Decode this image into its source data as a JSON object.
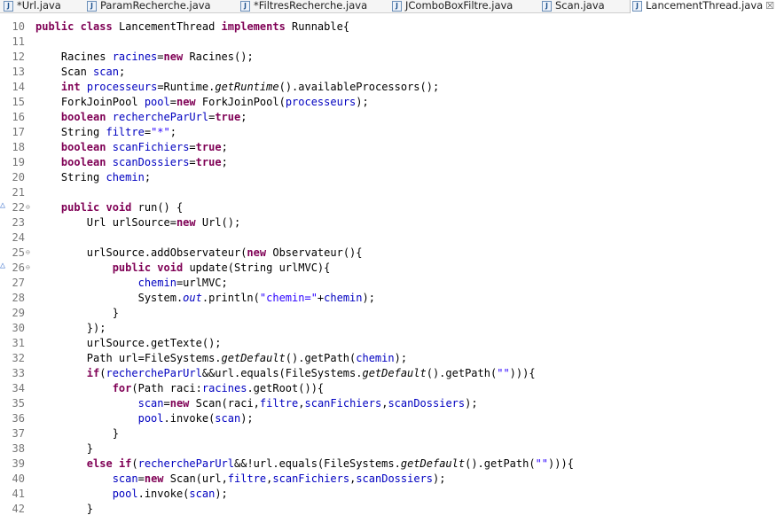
{
  "tabs": [
    {
      "label": "*Url.java",
      "icon": "java-file-icon",
      "active": false
    },
    {
      "label": "ParamRecherche.java",
      "icon": "java-file-icon",
      "active": false
    },
    {
      "label": "*FiltresRecherche.java",
      "icon": "java-file-icon",
      "active": false
    },
    {
      "label": "JComboBoxFiltre.java",
      "icon": "java-file-icon",
      "active": false
    },
    {
      "label": "Scan.java",
      "icon": "java-file-icon",
      "active": false
    },
    {
      "label": "LancementThread.java",
      "icon": "java-file-icon",
      "active": true,
      "close": "☒"
    }
  ],
  "icon_glyph": "J",
  "lines": [
    {
      "n": "10",
      "seg": [
        [
          "k",
          "public"
        ],
        [
          "",
          ""
        ],
        [
          "k",
          "class"
        ],
        [
          "",
          ""
        ],
        [
          "",
          "LancementThread "
        ],
        [
          "k",
          "implements"
        ],
        [
          "",
          ""
        ],
        [
          "",
          "Runnable{"
        ]
      ]
    },
    {
      "n": "11",
      "seg": []
    },
    {
      "n": "12",
      "seg": [
        [
          "",
          "    Racines "
        ],
        [
          "f",
          "racines"
        ],
        [
          "",
          "="
        ],
        [
          "k",
          "new"
        ],
        [
          "",
          ""
        ],
        [
          "",
          "Racines();"
        ]
      ]
    },
    {
      "n": "13",
      "seg": [
        [
          "",
          "    Scan "
        ],
        [
          "f",
          "scan"
        ],
        [
          "",
          ";"
        ]
      ]
    },
    {
      "n": "14",
      "seg": [
        [
          "",
          "    "
        ],
        [
          "k",
          "int"
        ],
        [
          "",
          ""
        ],
        [
          "f",
          "processeurs"
        ],
        [
          "",
          "=Runtime."
        ],
        [
          "i",
          "getRuntime"
        ],
        [
          "",
          "().availableProcessors();"
        ]
      ]
    },
    {
      "n": "15",
      "seg": [
        [
          "",
          "    ForkJoinPool "
        ],
        [
          "f",
          "pool"
        ],
        [
          "",
          "="
        ],
        [
          "k",
          "new"
        ],
        [
          "",
          ""
        ],
        [
          "",
          "ForkJoinPool("
        ],
        [
          "f",
          "processeurs"
        ],
        [
          "",
          ");"
        ]
      ]
    },
    {
      "n": "16",
      "seg": [
        [
          "",
          "    "
        ],
        [
          "k",
          "boolean"
        ],
        [
          "",
          ""
        ],
        [
          "f",
          "rechercheParUrl"
        ],
        [
          "",
          "="
        ],
        [
          "k",
          "true"
        ],
        [
          "",
          ";"
        ]
      ]
    },
    {
      "n": "17",
      "seg": [
        [
          "",
          "    String "
        ],
        [
          "f",
          "filtre"
        ],
        [
          "",
          "="
        ],
        [
          "s",
          "\"*\""
        ],
        [
          "",
          ";"
        ]
      ]
    },
    {
      "n": "18",
      "seg": [
        [
          "",
          "    "
        ],
        [
          "k",
          "boolean"
        ],
        [
          "",
          ""
        ],
        [
          "f",
          "scanFichiers"
        ],
        [
          "",
          "="
        ],
        [
          "k",
          "true"
        ],
        [
          "",
          ";"
        ]
      ]
    },
    {
      "n": "19",
      "seg": [
        [
          "",
          "    "
        ],
        [
          "k",
          "boolean"
        ],
        [
          "",
          ""
        ],
        [
          "f",
          "scanDossiers"
        ],
        [
          "",
          "="
        ],
        [
          "k",
          "true"
        ],
        [
          "",
          ";"
        ]
      ]
    },
    {
      "n": "20",
      "seg": [
        [
          "",
          "    String "
        ],
        [
          "f",
          "chemin"
        ],
        [
          "",
          ";"
        ]
      ]
    },
    {
      "n": "21",
      "seg": []
    },
    {
      "n": "22",
      "marker": "△",
      "fold": "⊖",
      "seg": [
        [
          "",
          "    "
        ],
        [
          "k",
          "public"
        ],
        [
          "",
          ""
        ],
        [
          "k",
          "void"
        ],
        [
          "",
          ""
        ],
        [
          "",
          "run() {"
        ]
      ]
    },
    {
      "n": "23",
      "seg": [
        [
          "",
          "        Url urlSource="
        ],
        [
          "k",
          "new"
        ],
        [
          "",
          ""
        ],
        [
          "",
          "Url();"
        ]
      ]
    },
    {
      "n": "24",
      "seg": []
    },
    {
      "n": "25",
      "fold": "⊖",
      "seg": [
        [
          "",
          "        urlSource.addObservateur("
        ],
        [
          "k",
          "new"
        ],
        [
          "",
          ""
        ],
        [
          "",
          "Observateur(){"
        ]
      ]
    },
    {
      "n": "26",
      "marker": "△",
      "fold": "⊖",
      "seg": [
        [
          "",
          "            "
        ],
        [
          "k",
          "public"
        ],
        [
          "",
          ""
        ],
        [
          "k",
          "void"
        ],
        [
          "",
          ""
        ],
        [
          "",
          "update(String urlMVC){"
        ]
      ]
    },
    {
      "n": "27",
      "seg": [
        [
          "",
          "                "
        ],
        [
          "f",
          "chemin"
        ],
        [
          "",
          "=urlMVC;"
        ]
      ]
    },
    {
      "n": "28",
      "seg": [
        [
          "",
          "                System."
        ],
        [
          "fi",
          "out"
        ],
        [
          "",
          ".println("
        ],
        [
          "s",
          "\"chemin=\""
        ],
        [
          "",
          "+"
        ],
        [
          "f",
          "chemin"
        ],
        [
          "",
          ");"
        ]
      ]
    },
    {
      "n": "29",
      "seg": [
        [
          "",
          "            }"
        ]
      ]
    },
    {
      "n": "30",
      "seg": [
        [
          "",
          "        });"
        ]
      ]
    },
    {
      "n": "31",
      "seg": [
        [
          "",
          "        urlSource.getTexte();"
        ]
      ]
    },
    {
      "n": "32",
      "seg": [
        [
          "",
          "        Path url=FileSystems."
        ],
        [
          "i",
          "getDefault"
        ],
        [
          "",
          "().getPath("
        ],
        [
          "f",
          "chemin"
        ],
        [
          "",
          ");"
        ]
      ]
    },
    {
      "n": "33",
      "seg": [
        [
          "",
          "        "
        ],
        [
          "k",
          "if"
        ],
        [
          "",
          "("
        ],
        [
          "f",
          "rechercheParUrl"
        ],
        [
          "",
          "&&url.equals(FileSystems."
        ],
        [
          "i",
          "getDefault"
        ],
        [
          "",
          "().getPath("
        ],
        [
          "s",
          "\"\""
        ],
        [
          "",
          "))){"
        ]
      ]
    },
    {
      "n": "34",
      "seg": [
        [
          "",
          "            "
        ],
        [
          "k",
          "for"
        ],
        [
          "",
          "(Path raci:"
        ],
        [
          "f",
          "racines"
        ],
        [
          "",
          ".getRoot()){"
        ]
      ]
    },
    {
      "n": "35",
      "seg": [
        [
          "",
          "                "
        ],
        [
          "f",
          "scan"
        ],
        [
          "",
          "="
        ],
        [
          "k",
          "new"
        ],
        [
          "",
          ""
        ],
        [
          "",
          "Scan(raci,"
        ],
        [
          "f",
          "filtre"
        ],
        [
          "",
          ","
        ],
        [
          "f",
          "scanFichiers"
        ],
        [
          "",
          ","
        ],
        [
          "f",
          "scanDossiers"
        ],
        [
          "",
          ");"
        ]
      ]
    },
    {
      "n": "36",
      "seg": [
        [
          "",
          "                "
        ],
        [
          "f",
          "pool"
        ],
        [
          "",
          ".invoke("
        ],
        [
          "f",
          "scan"
        ],
        [
          "",
          ");"
        ]
      ]
    },
    {
      "n": "37",
      "seg": [
        [
          "",
          "            }"
        ]
      ]
    },
    {
      "n": "38",
      "seg": [
        [
          "",
          "        }"
        ]
      ]
    },
    {
      "n": "39",
      "seg": [
        [
          "",
          "        "
        ],
        [
          "k",
          "else"
        ],
        [
          "",
          ""
        ],
        [
          "k",
          "if"
        ],
        [
          "",
          "("
        ],
        [
          "f",
          "rechercheParUrl"
        ],
        [
          "",
          "&&!url.equals(FileSystems."
        ],
        [
          "i",
          "getDefault"
        ],
        [
          "",
          "().getPath("
        ],
        [
          "s",
          "\"\""
        ],
        [
          "",
          "))){"
        ]
      ]
    },
    {
      "n": "40",
      "seg": [
        [
          "",
          "            "
        ],
        [
          "f",
          "scan"
        ],
        [
          "",
          "="
        ],
        [
          "k",
          "new"
        ],
        [
          "",
          ""
        ],
        [
          "",
          "Scan(url,"
        ],
        [
          "f",
          "filtre"
        ],
        [
          "",
          ","
        ],
        [
          "f",
          "scanFichiers"
        ],
        [
          "",
          ","
        ],
        [
          "f",
          "scanDossiers"
        ],
        [
          "",
          ");"
        ]
      ]
    },
    {
      "n": "41",
      "seg": [
        [
          "",
          "            "
        ],
        [
          "f",
          "pool"
        ],
        [
          "",
          ".invoke("
        ],
        [
          "f",
          "scan"
        ],
        [
          "",
          ");"
        ]
      ]
    },
    {
      "n": "42",
      "seg": [
        [
          "",
          "        }"
        ]
      ]
    }
  ]
}
